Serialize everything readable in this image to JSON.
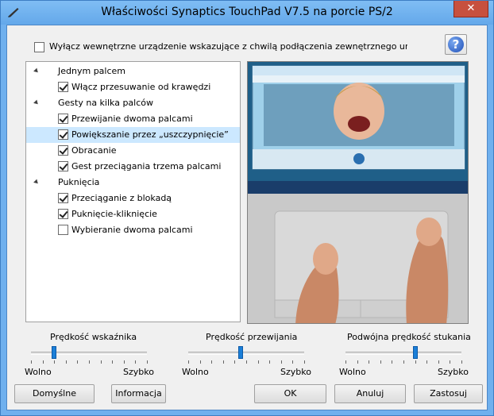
{
  "window": {
    "title": "Właściwości Synaptics TouchPad V7.5 na porcie PS/2",
    "close_label": "✕"
  },
  "external_device": {
    "checked": false,
    "label": "Wyłącz wewnętrzne urządzenie wskazujące z chwilą podłączenia zewnętrznego urządzenia wskazującego"
  },
  "help": {
    "label": "?"
  },
  "tree": {
    "groups": [
      {
        "label": "Jednym palcem",
        "items": [
          {
            "label": "Włącz przesuwanie od krawędzi",
            "checked": true
          }
        ]
      },
      {
        "label": "Gesty na kilka palców",
        "items": [
          {
            "label": "Przewijanie dwoma palcami",
            "checked": true
          },
          {
            "label": "Powiększanie przez „uszczypnięcie”",
            "checked": true
          },
          {
            "label": "Obracanie",
            "checked": true
          },
          {
            "label": "Gest przeciągania trzema palcami",
            "checked": true
          }
        ]
      },
      {
        "label": "Puknięcia",
        "items": [
          {
            "label": "Przeciąganie z blokadą",
            "checked": true
          },
          {
            "label": "Puknięcie-kliknięcie",
            "checked": true
          },
          {
            "label": "Wybieranie dwoma palcami",
            "checked": false
          }
        ]
      }
    ]
  },
  "sliders": [
    {
      "title": "Prędkość wskaźnika",
      "min": "Wolno",
      "max": "Szybko",
      "value": 0.2
    },
    {
      "title": "Prędkość przewijania",
      "min": "Wolno",
      "max": "Szybko",
      "value": 0.45
    },
    {
      "title": "Podwójna prędkość stukania",
      "min": "Wolno",
      "max": "Szybko",
      "value": 0.6
    }
  ],
  "buttons": {
    "defaults": "Domyślne",
    "info": "Informacja",
    "ok": "OK",
    "cancel": "Anuluj",
    "apply": "Zastosuj"
  }
}
